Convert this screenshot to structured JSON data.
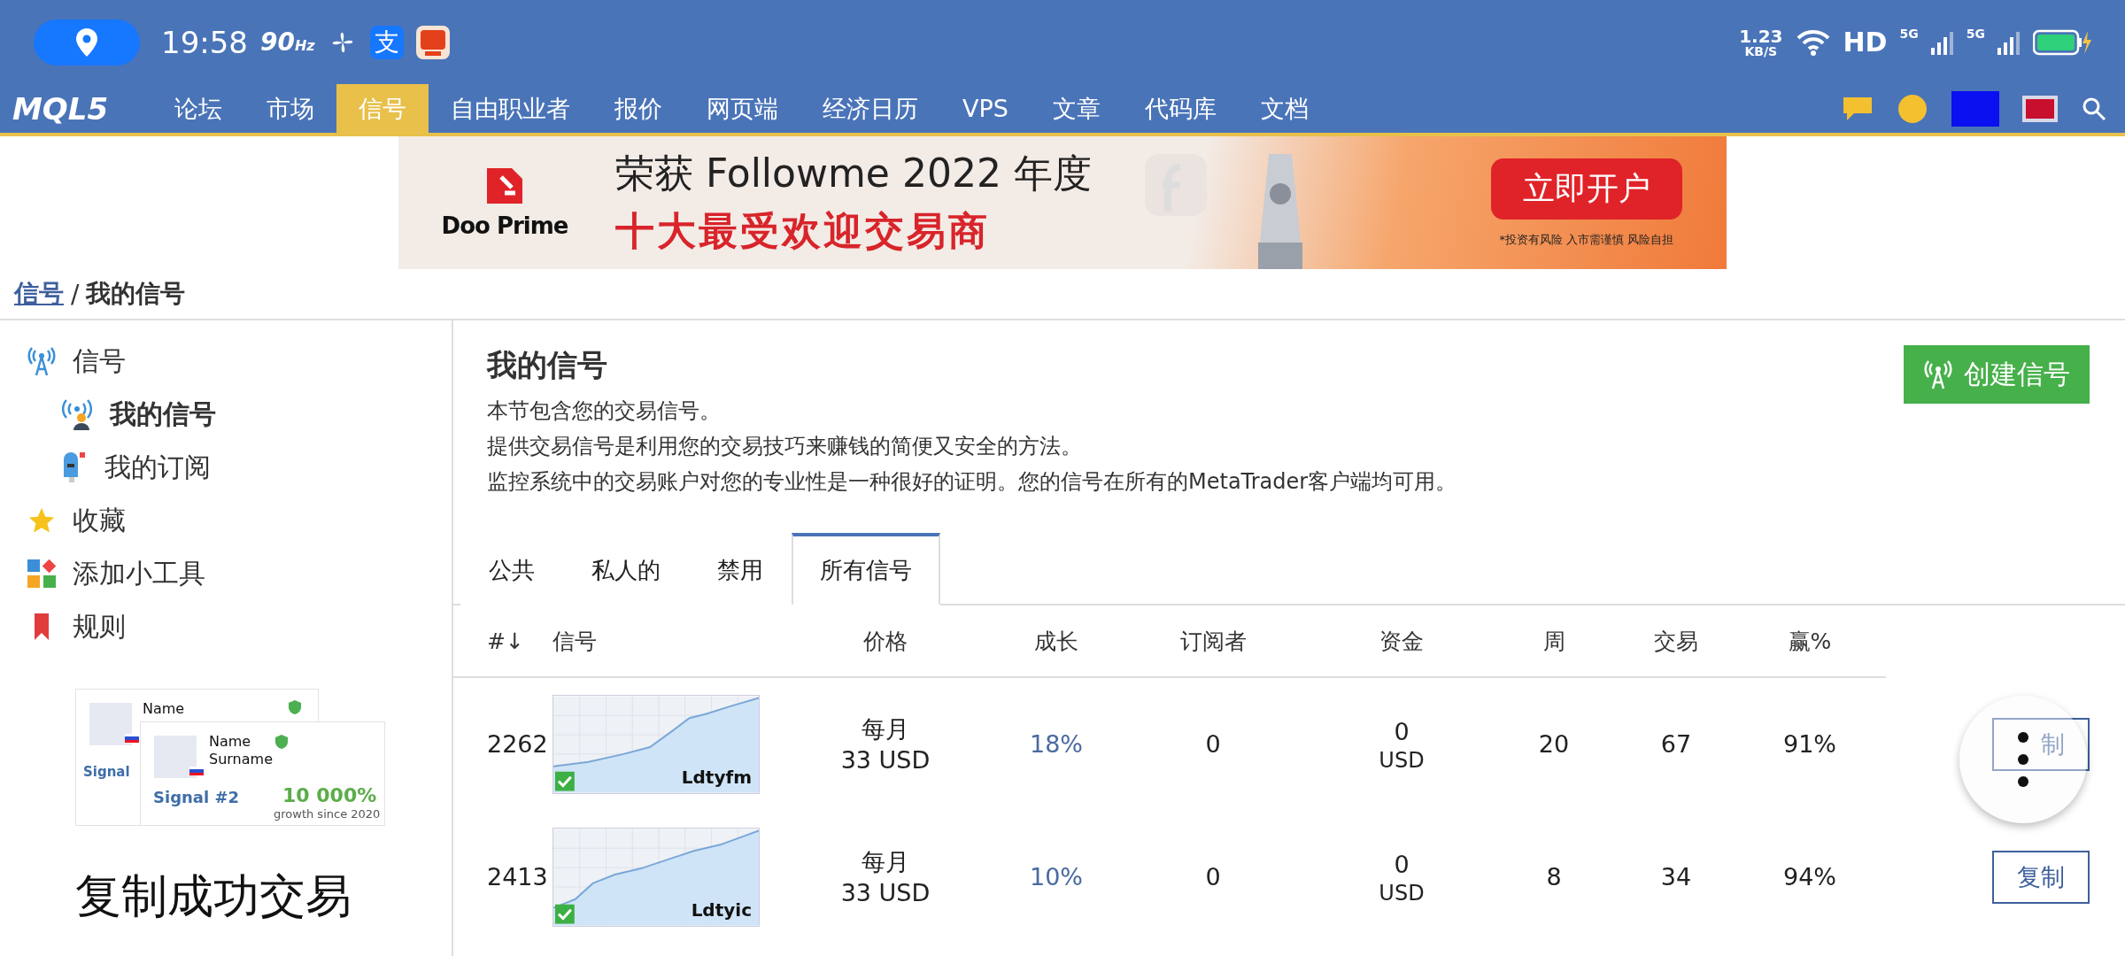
{
  "status_bar": {
    "time": "19:58",
    "refresh": "90",
    "refresh_unit": "Hz",
    "app_char": "支",
    "net_speed": "1.23",
    "net_unit": "KB/S",
    "hd": "HD",
    "networks": [
      "5G",
      "5G"
    ]
  },
  "nav": {
    "logo": "MQL5",
    "items": [
      {
        "label": "论坛",
        "selected": false
      },
      {
        "label": "市场",
        "selected": false
      },
      {
        "label": "信号",
        "selected": true
      },
      {
        "label": "自由职业者",
        "selected": false
      },
      {
        "label": "报价",
        "selected": false
      },
      {
        "label": "网页端",
        "selected": false
      },
      {
        "label": "经济日历",
        "selected": false
      },
      {
        "label": "VPS",
        "selected": false
      },
      {
        "label": "文章",
        "selected": false
      },
      {
        "label": "代码库",
        "selected": false
      },
      {
        "label": "文档",
        "selected": false
      }
    ]
  },
  "banner": {
    "brand": "Doo Prime",
    "headline": "荣获 Followme 2022 年度",
    "subline": "十大最受欢迎交易商",
    "cta": "立即开户",
    "disclaimer": "*投资有风险 入市需谨慎 风险自担"
  },
  "breadcrumb": {
    "link": "信号",
    "separator": "/",
    "current": "我的信号"
  },
  "sidebar": {
    "items": [
      {
        "label": "信号",
        "kind": "antenna",
        "selected": false,
        "children": [
          {
            "label": "我的信号",
            "kind": "broadcaster",
            "selected": true
          },
          {
            "label": "我的订阅",
            "kind": "mailbox",
            "selected": false
          }
        ]
      },
      {
        "label": "收藏",
        "kind": "star",
        "selected": false
      },
      {
        "label": "添加小工具",
        "kind": "widgets",
        "selected": false
      },
      {
        "label": "规则",
        "kind": "bookmark",
        "selected": false
      }
    ],
    "promo": {
      "back_card": {
        "name": "Name",
        "signal": "Signal"
      },
      "front_card": {
        "name": "Name",
        "surname": "Surname",
        "signal": "Signal #2",
        "growth": "10 000%",
        "growth_note": "growth since 2020"
      },
      "heading": "复制成功交易"
    }
  },
  "main": {
    "title": "我的信号",
    "create_button": "创建信号",
    "description": [
      "本节包含您的交易信号。",
      "提供交易信号是利用您的交易技巧来赚钱的简便又安全的方法。",
      "监控系统中的交易账户对您的专业性是一种很好的证明。您的信号在所有的MetaTrader客户端均可用。"
    ],
    "tabs": [
      {
        "label": "公共",
        "selected": false
      },
      {
        "label": "私人的",
        "selected": false
      },
      {
        "label": "禁用",
        "selected": false
      },
      {
        "label": "所有信号",
        "selected": true
      }
    ],
    "table": {
      "columns": [
        "#↓",
        "信号",
        "价格",
        "成长",
        "订阅者",
        "资金",
        "周",
        "交易",
        "赢%"
      ],
      "rows": [
        {
          "number": "2262",
          "signal": "Ldtyfm",
          "price_period": "每月",
          "price": "33 USD",
          "growth": "18%",
          "subscribers": "0",
          "funds": "0",
          "funds_unit": "USD",
          "weeks": "20",
          "trades": "67",
          "win": "91%",
          "action": "制"
        },
        {
          "number": "2413",
          "signal": "Ldtyic",
          "price_period": "每月",
          "price": "33 USD",
          "growth": "10%",
          "subscribers": "0",
          "funds": "0",
          "funds_unit": "USD",
          "weeks": "8",
          "trades": "34",
          "win": "94%",
          "action": "复制"
        }
      ]
    }
  }
}
